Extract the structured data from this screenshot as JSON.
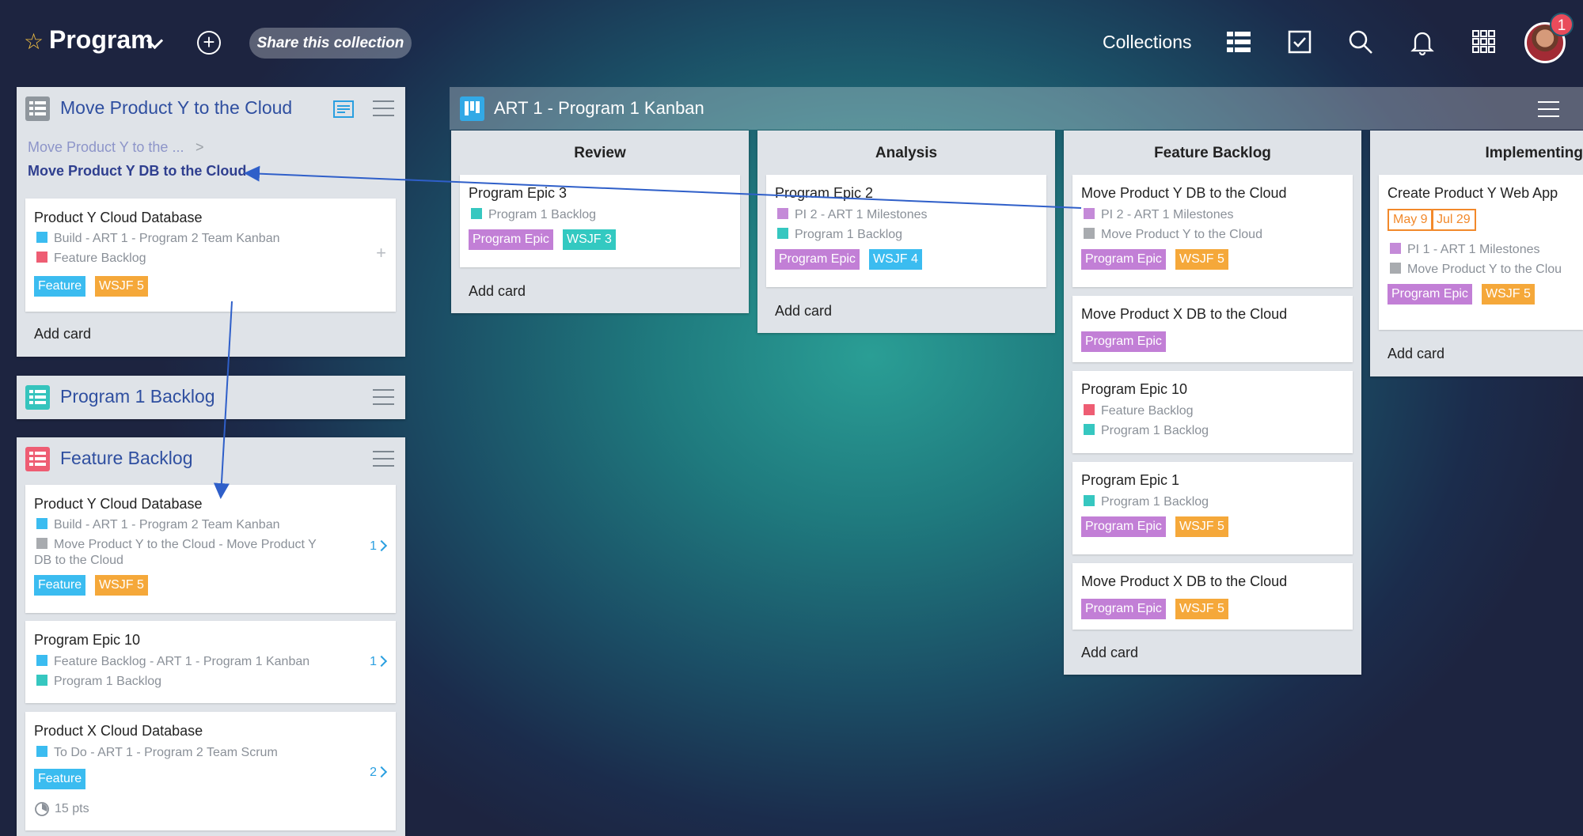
{
  "header": {
    "title": "Program",
    "share_label": "Share this collection",
    "collections_label": "Collections",
    "notification_count": "1"
  },
  "icons": {
    "star": "star-icon",
    "add": "plus-circle-icon",
    "list": "list-icon",
    "check": "checkbox-icon",
    "search": "search-icon",
    "bell": "bell-icon",
    "apps": "grid-icon"
  },
  "colors": {
    "feature": "#3bbcf0",
    "wsjf": "#f5a83a",
    "program_epic": "#c27fd6",
    "wsjf_teal": "#33c9c1",
    "teal_sq": "#36c7c0",
    "pink_sq": "#ee5d73",
    "blue_sq": "#3bbcf0",
    "purple_sq": "#c48ad8",
    "grey_sq": "#a8abaf"
  },
  "left": {
    "panel1": {
      "title": "Move Product Y to the Cloud",
      "breadcrumb_parent": "Move Product Y to the ...",
      "breadcrumb_sep": ">",
      "breadcrumb_current": "Move Product Y DB to the Cloud",
      "card": {
        "title": "Product Y Cloud Database",
        "meta1": "Build - ART 1 - Program 2 Team Kanban",
        "meta2": "Feature Backlog",
        "tag1": "Feature",
        "tag2": "WSJF 5",
        "plus": "+"
      },
      "add_card": "Add card"
    },
    "panel2": {
      "title": "Program 1 Backlog"
    },
    "panel3": {
      "title": "Feature Backlog",
      "cards": [
        {
          "title": "Product Y Cloud Database",
          "meta1": "Build - ART 1 - Program 2 Team Kanban",
          "meta2a": "Move Product Y to the Cloud - Move Product Y",
          "meta2b": "DB to the Cloud",
          "tag1": "Feature",
          "tag2": "WSJF 5",
          "count": "1"
        },
        {
          "title": "Program Epic 10",
          "meta1": "Feature Backlog - ART 1 - Program 1 Kanban",
          "meta2": "Program 1 Backlog",
          "count": "1"
        },
        {
          "title": "Product X Cloud Database",
          "meta1": "To Do - ART 1 - Program 2 Team Scrum",
          "tag1": "Feature",
          "points": "15 pts",
          "count": "2"
        }
      ]
    }
  },
  "kanban": {
    "title": "ART 1 - Program 1 Kanban",
    "columns": [
      {
        "name": "Review",
        "cards": [
          {
            "title": "Program Epic 3",
            "meta1": "Program 1 Backlog",
            "tag1": "Program Epic",
            "tag2": "WSJF 3"
          }
        ],
        "add_card": "Add card"
      },
      {
        "name": "Analysis",
        "cards": [
          {
            "title": "Program Epic 2",
            "meta1": "PI 2 - ART 1 Milestones",
            "meta2": "Program 1 Backlog",
            "tag1": "Program Epic",
            "tag2": "WSJF 4"
          }
        ],
        "add_card": "Add card"
      },
      {
        "name": "Feature Backlog",
        "cards": [
          {
            "title": "Move Product Y DB to the Cloud",
            "meta1": "PI 2 - ART 1 Milestones",
            "meta2": "Move Product Y to the Cloud",
            "tag1": "Program Epic",
            "tag2": "WSJF 5"
          },
          {
            "title": "Move Product X DB to the Cloud",
            "tag1": "Program Epic"
          },
          {
            "title": "Program Epic 10",
            "meta1": "Feature Backlog",
            "meta2": "Program 1 Backlog"
          },
          {
            "title": "Program Epic 1",
            "meta1": "Program 1 Backlog",
            "tag1": "Program Epic",
            "tag2": "WSJF 5"
          },
          {
            "title": "Move Product X DB to the Cloud",
            "tag1": "Program Epic",
            "tag2": "WSJF 5"
          }
        ],
        "add_card": "Add card"
      },
      {
        "name": "Implementing",
        "cards": [
          {
            "title": "Create Product Y Web App",
            "date1": "May 9",
            "date2": "Jul 29",
            "meta1": "PI 1 - ART 1 Milestones",
            "meta2": "Move Product Y to the Clou",
            "tag1": "Program Epic",
            "tag2": "WSJF 5"
          }
        ],
        "add_card": "Add card"
      }
    ]
  }
}
